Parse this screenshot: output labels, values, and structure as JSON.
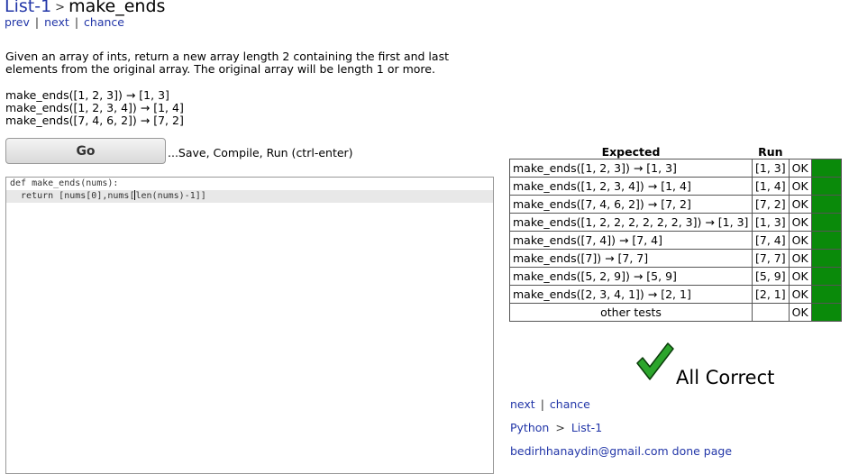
{
  "header": {
    "crumb": "List-1",
    "title": "make_ends",
    "nav": {
      "prev": "prev",
      "next": "next",
      "chance": "chance",
      "sep": "|"
    }
  },
  "description": "Given an array of ints, return a new array length 2 containing the first and last elements from the original array. The original array will be length 1 or more.",
  "examples": [
    "make_ends([1, 2, 3]) → [1, 3]",
    "make_ends([1, 2, 3, 4]) → [1, 4]",
    "make_ends([7, 4, 6, 2]) → [7, 2]"
  ],
  "go": {
    "label": "Go",
    "hint": "...Save, Compile, Run (ctrl-enter)"
  },
  "editor": {
    "line1": "def make_ends(nums):",
    "line2_before": "  return [nums[0],nums[",
    "line2_after": "len(nums)-1]]"
  },
  "results": {
    "col_expected": "Expected",
    "col_run": "Run",
    "rows": [
      {
        "expected": "make_ends([1, 2, 3]) → [1, 3]",
        "run": "[1, 3]",
        "status": "OK"
      },
      {
        "expected": "make_ends([1, 2, 3, 4]) → [1, 4]",
        "run": "[1, 4]",
        "status": "OK"
      },
      {
        "expected": "make_ends([7, 4, 6, 2]) → [7, 2]",
        "run": "[7, 2]",
        "status": "OK"
      },
      {
        "expected": "make_ends([1, 2, 2, 2, 2, 2, 2, 3]) → [1, 3]",
        "run": "[1, 3]",
        "status": "OK"
      },
      {
        "expected": "make_ends([7, 4]) → [7, 4]",
        "run": "[7, 4]",
        "status": "OK"
      },
      {
        "expected": "make_ends([7]) → [7, 7]",
        "run": "[7, 7]",
        "status": "OK"
      },
      {
        "expected": "make_ends([5, 2, 9]) → [5, 9]",
        "run": "[5, 9]",
        "status": "OK"
      },
      {
        "expected": "make_ends([2, 3, 4, 1]) → [2, 1]",
        "run": "[2, 1]",
        "status": "OK"
      }
    ],
    "other": {
      "label": "other tests",
      "status": "OK"
    },
    "pass_color": "#0a8a0a"
  },
  "all_correct": {
    "text": "All Correct",
    "icon": "checkmark-icon",
    "color": "#2ca52c"
  },
  "footer": {
    "next": "next",
    "chance": "chance",
    "sep": "|",
    "crumb_lang": "Python",
    "crumb_gt": ">",
    "crumb_list": "List-1",
    "user_email": "bedirhhanaydin@gmail.com",
    "done_page": "done page"
  }
}
